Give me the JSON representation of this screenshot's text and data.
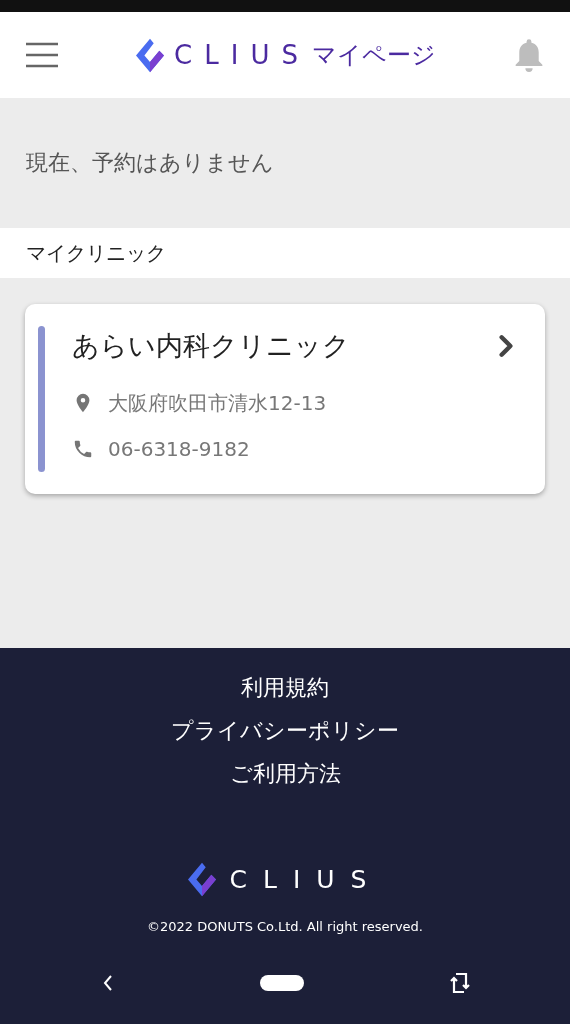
{
  "header": {
    "logo": "CLIUS",
    "title": "マイページ"
  },
  "notice": "現在、予約はありません",
  "section_title": "マイクリニック",
  "clinics": [
    {
      "name": "あらい内科クリニック",
      "address": "大阪府吹田市清水12-13",
      "phone": "06-6318-9182"
    }
  ],
  "footer": {
    "links": [
      "利用規約",
      "プライバシーポリシー",
      "ご利用方法"
    ],
    "logo": "CLIUS",
    "copyright": "©2022 DONUTS Co.Ltd. All right reserved."
  }
}
